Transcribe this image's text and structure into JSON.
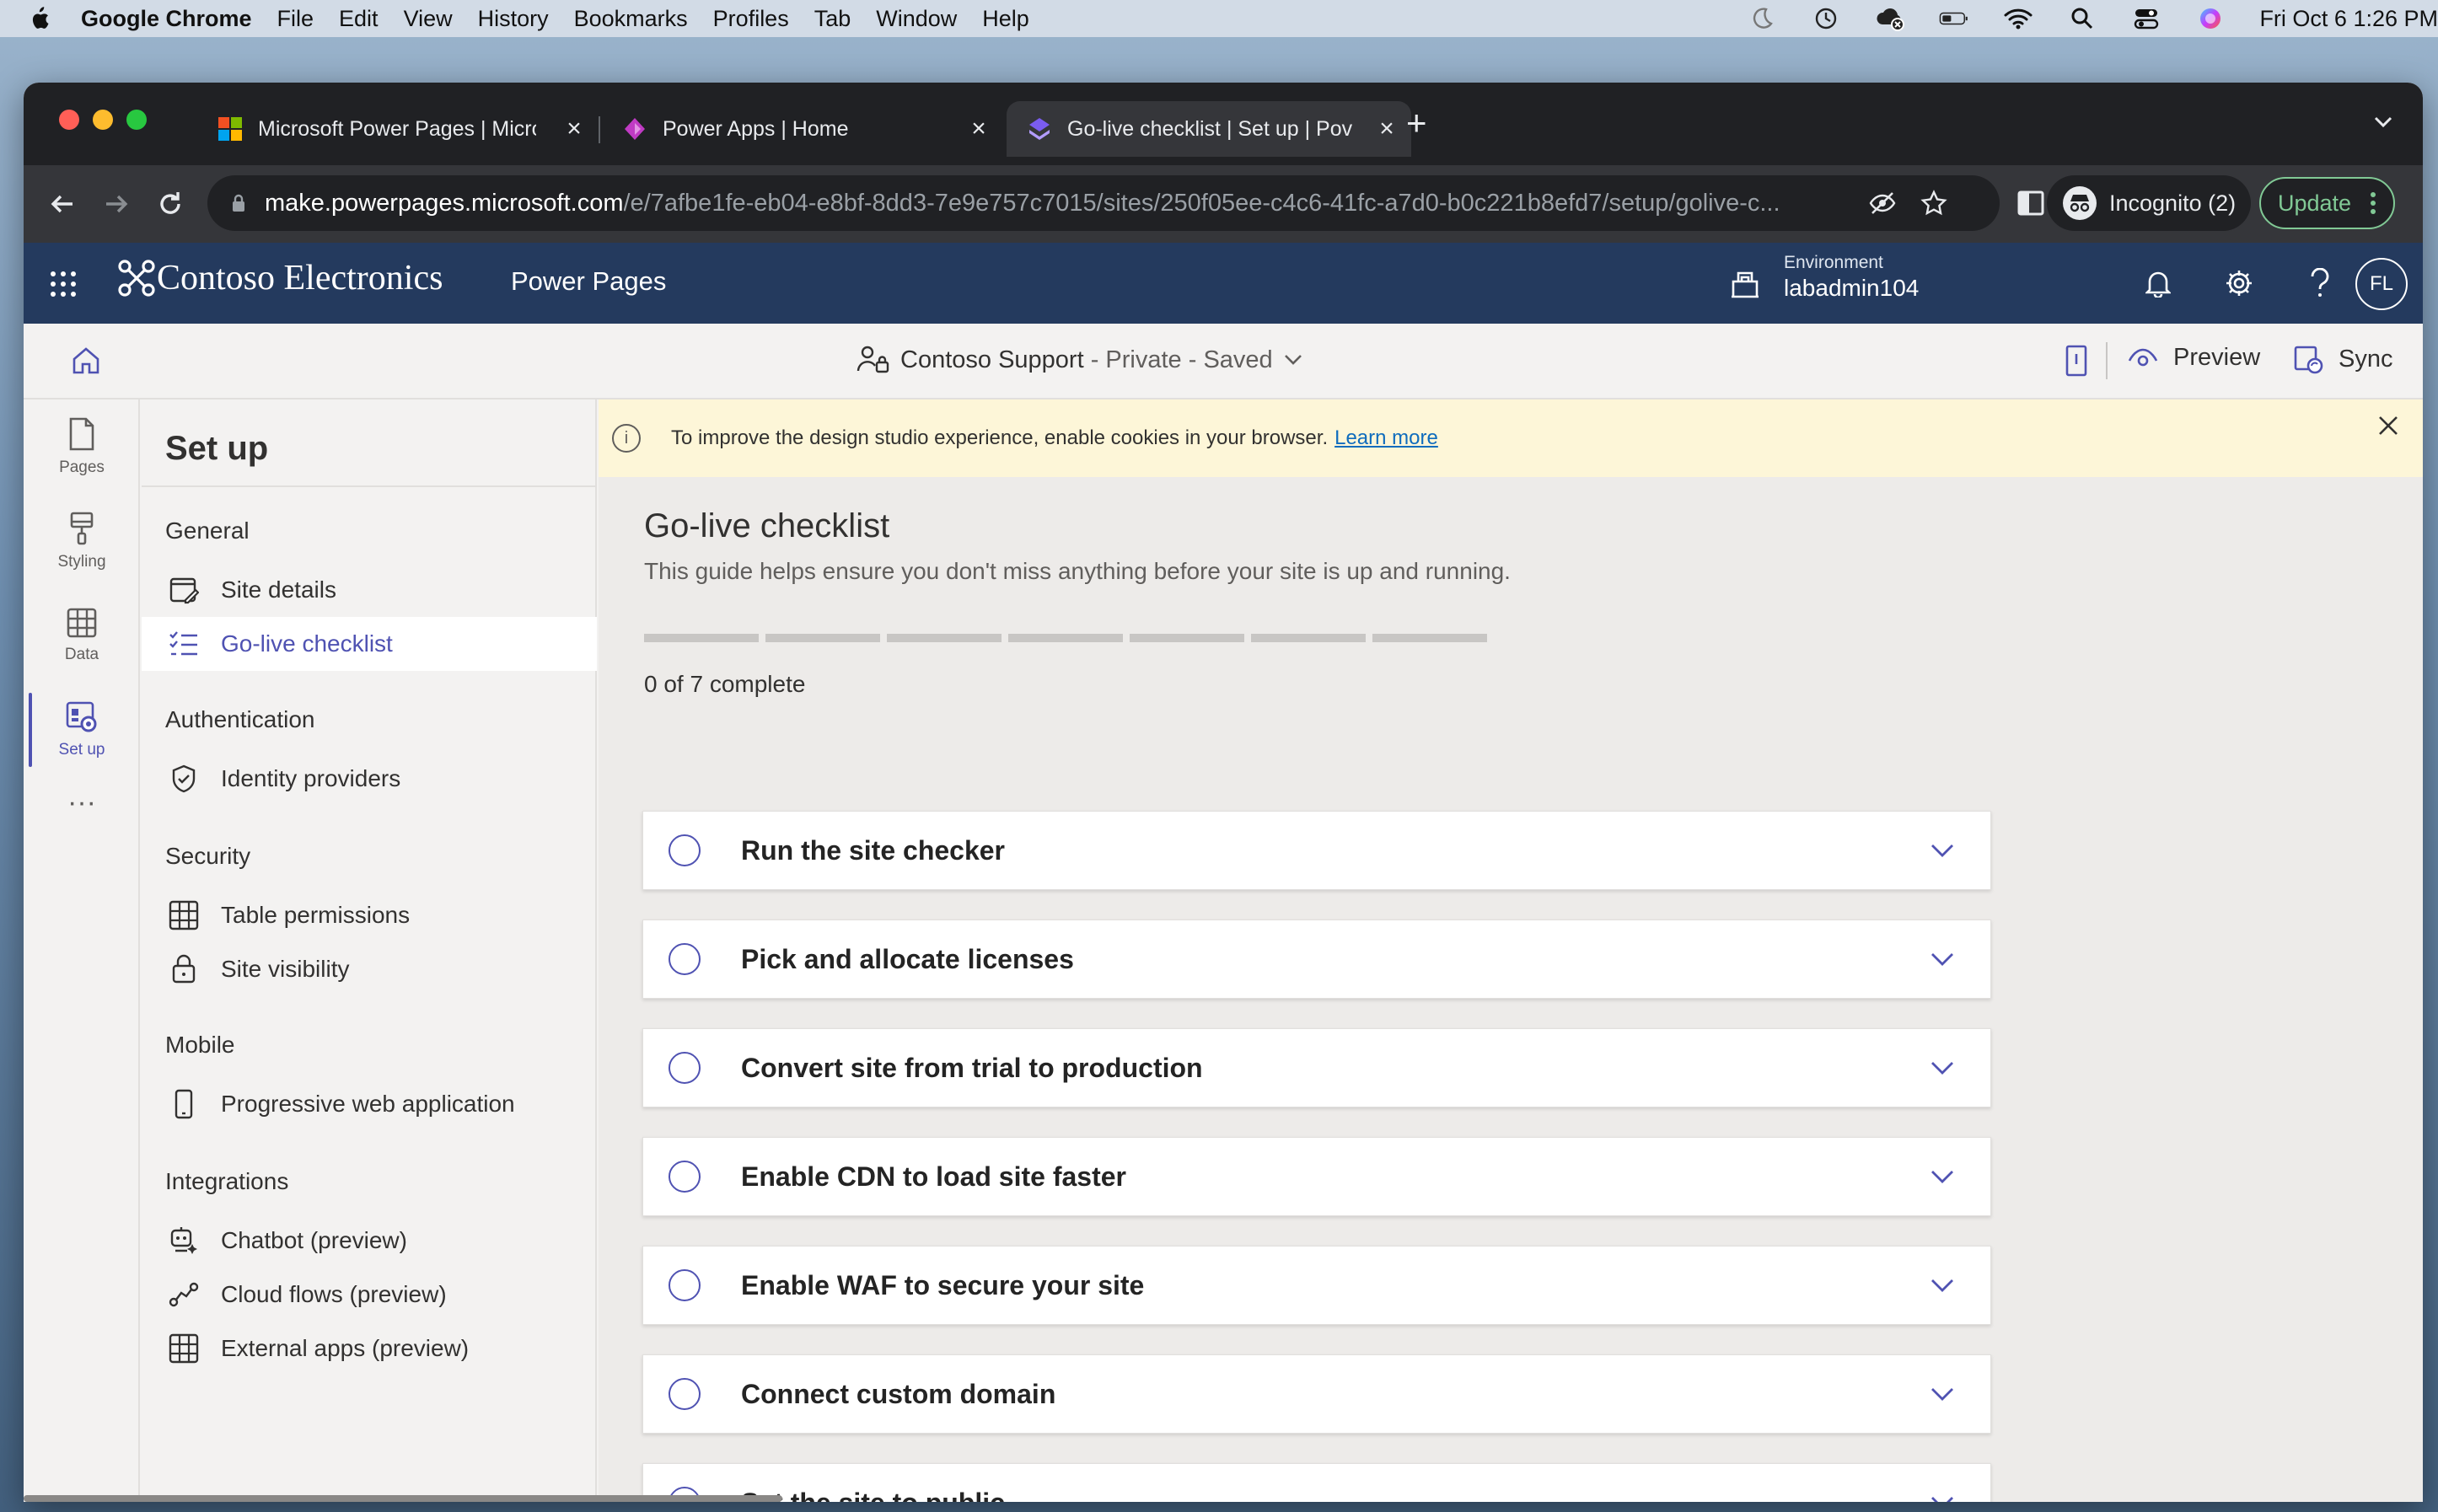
{
  "menubar": {
    "app": "Google Chrome",
    "items": [
      "File",
      "Edit",
      "View",
      "History",
      "Bookmarks",
      "Profiles",
      "Tab",
      "Window",
      "Help"
    ],
    "clock": "Fri Oct 6  1:26 PM"
  },
  "browser": {
    "tabs": [
      {
        "title": "Microsoft Power Pages | Micro",
        "favicon": "microsoft-logo"
      },
      {
        "title": "Power Apps | Home",
        "favicon": "power-apps-logo"
      },
      {
        "title": "Go-live checklist | Set up | Pov",
        "favicon": "power-pages-logo",
        "active": true
      }
    ],
    "url_host": "make.powerpages.microsoft.com",
    "url_path": "/e/7afbe1fe-eb04-e8bf-8dd3-7e9e757c7015/sites/250f05ee-c4c6-41fc-a7d0-b0c221b8efd7/setup/golive-c...",
    "incognito_label": "Incognito (2)",
    "update_label": "Update"
  },
  "header": {
    "brand": "Contoso Electronics",
    "product": "Power Pages",
    "environment_label": "Environment",
    "environment_value": "labadmin104",
    "avatar_initials": "FL"
  },
  "commandbar": {
    "site_name": "Contoso Support",
    "site_meta": " - Private - Saved",
    "preview_label": "Preview",
    "sync_label": "Sync"
  },
  "rail": {
    "items": [
      {
        "label": "Pages"
      },
      {
        "label": "Styling"
      },
      {
        "label": "Data"
      },
      {
        "label": "Set up"
      }
    ]
  },
  "sidenav": {
    "title": "Set up",
    "groups": {
      "general": "General",
      "authentication": "Authentication",
      "security": "Security",
      "mobile": "Mobile",
      "integrations": "Integrations"
    },
    "items": {
      "site_details": "Site details",
      "golive": "Go-live checklist",
      "identity": "Identity providers",
      "table_permissions": "Table permissions",
      "site_visibility": "Site visibility",
      "pwa": "Progressive web application",
      "chatbot": "Chatbot (preview)",
      "cloud_flows": "Cloud flows (preview)",
      "external_apps": "External apps (preview)"
    }
  },
  "cookie_banner": {
    "message": "To improve the design studio experience, enable cookies in your browser.",
    "link": "Learn more"
  },
  "checklist": {
    "title": "Go-live checklist",
    "description": "This guide helps ensure you don't miss anything before your site is up and running.",
    "completed": 0,
    "total": 7,
    "count_text": "0 of 7 complete",
    "items": [
      "Run the site checker",
      "Pick and allocate licenses",
      "Convert site from trial to production",
      "Enable CDN to load site faster",
      "Enable WAF to secure your site",
      "Connect custom domain",
      "Set the site to public"
    ]
  },
  "colors": {
    "accent": "#4f52b2",
    "header_bg": "#243a5e",
    "banner_bg": "#fdf6d8"
  }
}
